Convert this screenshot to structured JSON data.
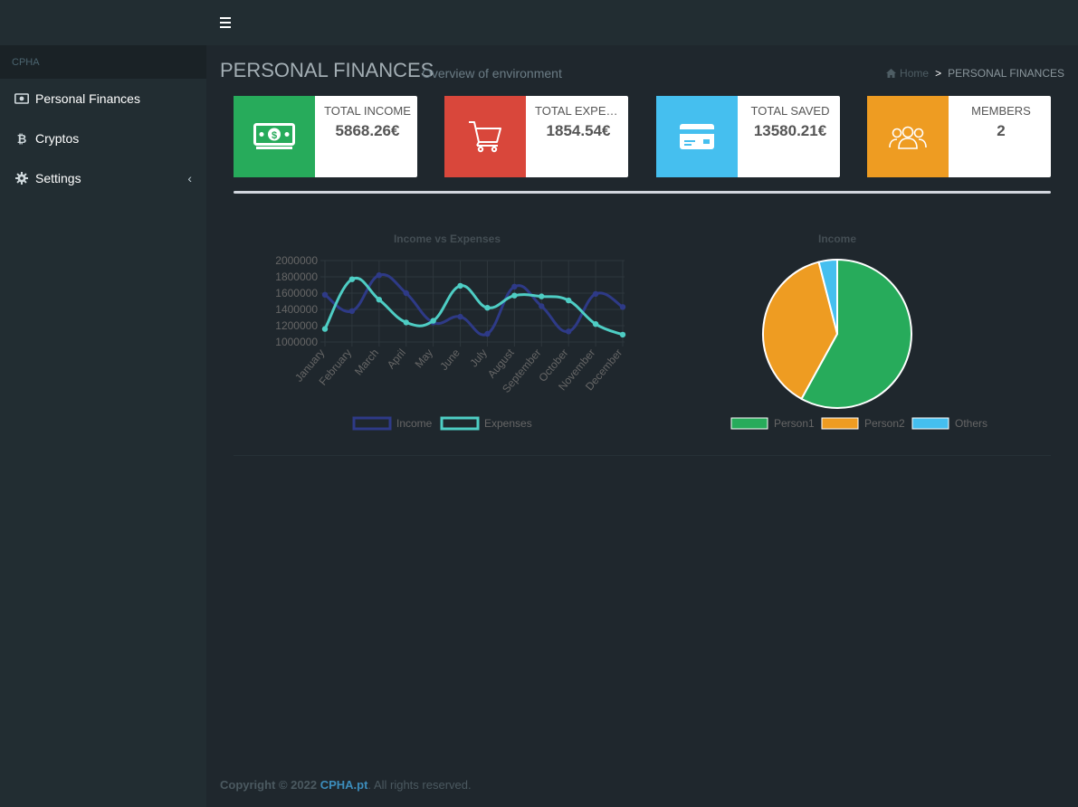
{
  "header": {
    "menu_toggle": "menu"
  },
  "sidebar": {
    "header": "CPHA",
    "items": [
      {
        "label": "Personal Finances",
        "icon": "money-icon"
      },
      {
        "label": "Cryptos",
        "icon": "bitcoin-icon"
      },
      {
        "label": "Settings",
        "icon": "gear-icon",
        "chevron": "‹"
      }
    ]
  },
  "page": {
    "title": "PERSONAL FINANCES",
    "subtitle": "Overview of environment",
    "breadcrumb": {
      "home": "Home",
      "separator": ">",
      "current": "PERSONAL FINANCES"
    }
  },
  "stats": [
    {
      "label": "TOTAL INCOME",
      "value": "5868.26€",
      "color": "#27ab5b",
      "icon": "money-bill-icon"
    },
    {
      "label": "TOTAL EXPENSES",
      "value": "1854.54€",
      "color": "#d9473b",
      "icon": "cart-icon"
    },
    {
      "label": "TOTAL SAVED",
      "value": "13580.21€",
      "color": "#45bfef",
      "icon": "credit-card-icon"
    },
    {
      "label": "MEMBERS",
      "value": "2",
      "color": "#ee9c22",
      "icon": "users-icon"
    }
  ],
  "chart_data": [
    {
      "type": "line",
      "title": "Income vs Expenses",
      "categories": [
        "January",
        "February",
        "March",
        "April",
        "May",
        "June",
        "July",
        "August",
        "September",
        "October",
        "November",
        "December"
      ],
      "series": [
        {
          "name": "Income",
          "color": "#2e3a87",
          "values": [
            1580000,
            1380000,
            1820000,
            1600000,
            1240000,
            1310000,
            1100000,
            1680000,
            1440000,
            1130000,
            1590000,
            1430000
          ]
        },
        {
          "name": "Expenses",
          "color": "#4ecdc4",
          "values": [
            1160000,
            1770000,
            1520000,
            1240000,
            1260000,
            1690000,
            1420000,
            1570000,
            1560000,
            1510000,
            1220000,
            1090000
          ]
        }
      ],
      "y_ticks": [
        "2000000",
        "1800000",
        "1600000",
        "1400000",
        "1200000",
        "1000000"
      ],
      "ylim": [
        1000000,
        2000000
      ],
      "grid": true,
      "legend": "bottom"
    },
    {
      "type": "pie",
      "title": "Income",
      "series": [
        {
          "name": "Person1",
          "color": "#27ab5b",
          "value": 58
        },
        {
          "name": "Person2",
          "color": "#ee9c22",
          "value": 38
        },
        {
          "name": "Others",
          "color": "#45bfef",
          "value": 4
        }
      ],
      "legend": "bottom"
    }
  ],
  "footer": {
    "copyright": "Copyright © 2022 ",
    "brand": "CPHA.pt",
    "rights": ". All rights reserved."
  }
}
